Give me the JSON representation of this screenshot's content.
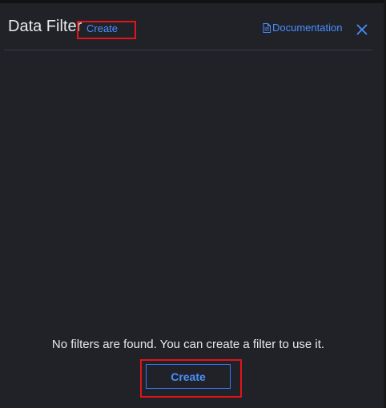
{
  "panel": {
    "title": "Data Filter",
    "header_create_label": "Create",
    "documentation_label": "Documentation",
    "close_icon": "close-icon",
    "doc_icon": "document-icon"
  },
  "empty_state": {
    "message": "No filters are found. You can create a filter to use it.",
    "create_button_label": "Create"
  },
  "colors": {
    "background": "#202228",
    "accent": "#4a8fff",
    "text": "#e8e9ec",
    "highlight": "#e0151a"
  }
}
